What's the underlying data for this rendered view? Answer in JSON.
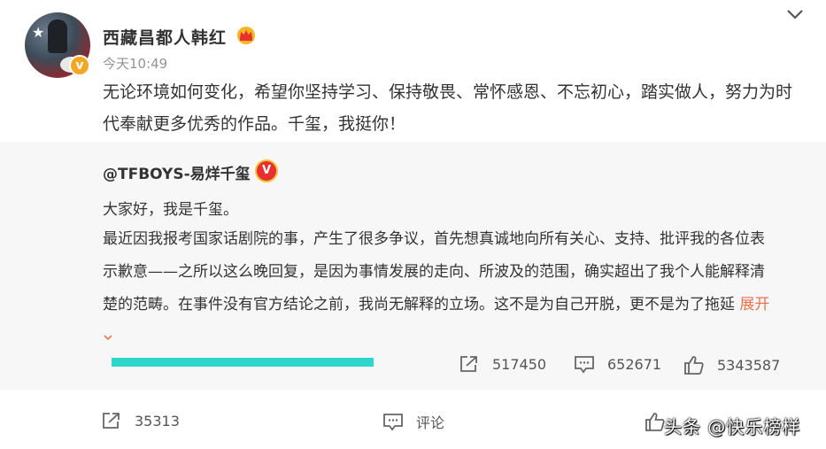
{
  "post": {
    "author": "西藏昌都人韩红",
    "time": "今天10:49",
    "text": "无论环境如何变化，希望你坚持学习、保持敬畏、常怀感恩、不忘初心，踏实做人，努力为时代奉献更多优秀的作品。千玺，我挺你！",
    "actions": {
      "share_count": "35313",
      "comment_label": "评论"
    }
  },
  "repost": {
    "author": "@TFBOYS-易烊千玺",
    "greeting": "大家好，我是千玺。",
    "body": "最近因我报考国家话剧院的事，产生了很多争议，首先想真诚地向所有关心、支持、批评我的各位表示歉意——之所以这么晚回复，是因为事情发展的走向、所波及的范围，确实超出了我个人能解释清楚的范畴。在事件没有官方结论之前，我尚无解释的立场。这不是为自己开脱，更不是为了拖延",
    "expand_label": "展开",
    "stats": {
      "reposts": "517450",
      "comments": "652671",
      "likes": "5343587"
    }
  },
  "watermark": "头条 @快乐榜样",
  "colors": {
    "expand": "#eb7350",
    "repost_bg": "#f7f7f7",
    "redaction": "#2fd6cc"
  }
}
